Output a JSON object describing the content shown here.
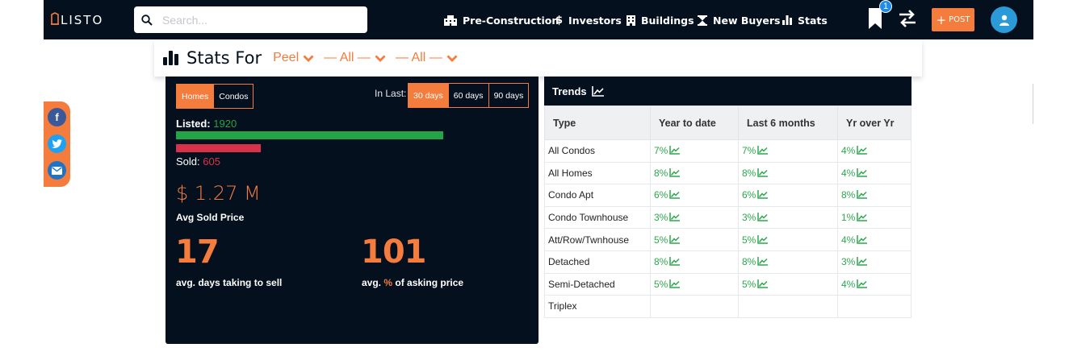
{
  "nav": {
    "logo": "LISTO",
    "search_placeholder": "Search...",
    "items": [
      {
        "label": "Pre-Construction",
        "icon": "building-icon"
      },
      {
        "label": "Investors",
        "icon": "dollar-icon"
      },
      {
        "label": "Buildings",
        "icon": "office-building-icon"
      },
      {
        "label": "New Buyers",
        "icon": "hourglass-icon"
      },
      {
        "label": "Stats",
        "icon": "bar-chart-icon"
      }
    ],
    "bookmark_count": "1",
    "post_label": "POST"
  },
  "stats_bar": {
    "title": "Stats For",
    "filters": [
      "Peel",
      "— All —",
      "— All —"
    ]
  },
  "panel": {
    "type_tabs": [
      "Homes",
      "Condos"
    ],
    "active_type": "Homes",
    "in_last_label": "In Last:",
    "period_tabs": [
      "30 days",
      "60 days",
      "90 days"
    ],
    "active_period": "30 days",
    "listed_label": "Listed:",
    "listed_value": "1920",
    "sold_label": "Sold:",
    "sold_value": "605",
    "avg_price": "$ 1.27 M",
    "avg_price_label": "Avg Sold Price",
    "days_value": "17",
    "days_label": "avg. days taking to sell",
    "asking_value": "101",
    "asking_label_pre": "avg.",
    "asking_label_pct": "%",
    "asking_label_post": "of asking price"
  },
  "trends": {
    "title": "Trends",
    "columns": [
      "Type",
      "Year to date",
      "Last 6 months",
      "Yr over Yr"
    ],
    "rows": [
      {
        "type": "All Condos",
        "ytd": "7%",
        "six": "7%",
        "yoy": "4%"
      },
      {
        "type": "All Homes",
        "ytd": "8%",
        "six": "8%",
        "yoy": "4%"
      },
      {
        "type": "Condo Apt",
        "ytd": "6%",
        "six": "6%",
        "yoy": "8%"
      },
      {
        "type": "Condo Townhouse",
        "ytd": "3%",
        "six": "3%",
        "yoy": "1%"
      },
      {
        "type": "Att/Row/Twnhouse",
        "ytd": "5%",
        "six": "5%",
        "yoy": "4%"
      },
      {
        "type": "Detached",
        "ytd": "8%",
        "six": "8%",
        "yoy": "3%"
      },
      {
        "type": "Semi-Detached",
        "ytd": "5%",
        "six": "5%",
        "yoy": "4%"
      },
      {
        "type": "Triplex",
        "ytd": "",
        "six": "",
        "yoy": ""
      }
    ]
  },
  "share": [
    "facebook-icon",
    "twitter-icon",
    "email-icon"
  ],
  "colors": {
    "accent": "#f47c3c",
    "dark": "#05101f",
    "listed_bar": "#22a447",
    "sold_bar": "#d8324a",
    "trend_green": "#2ca84e"
  }
}
